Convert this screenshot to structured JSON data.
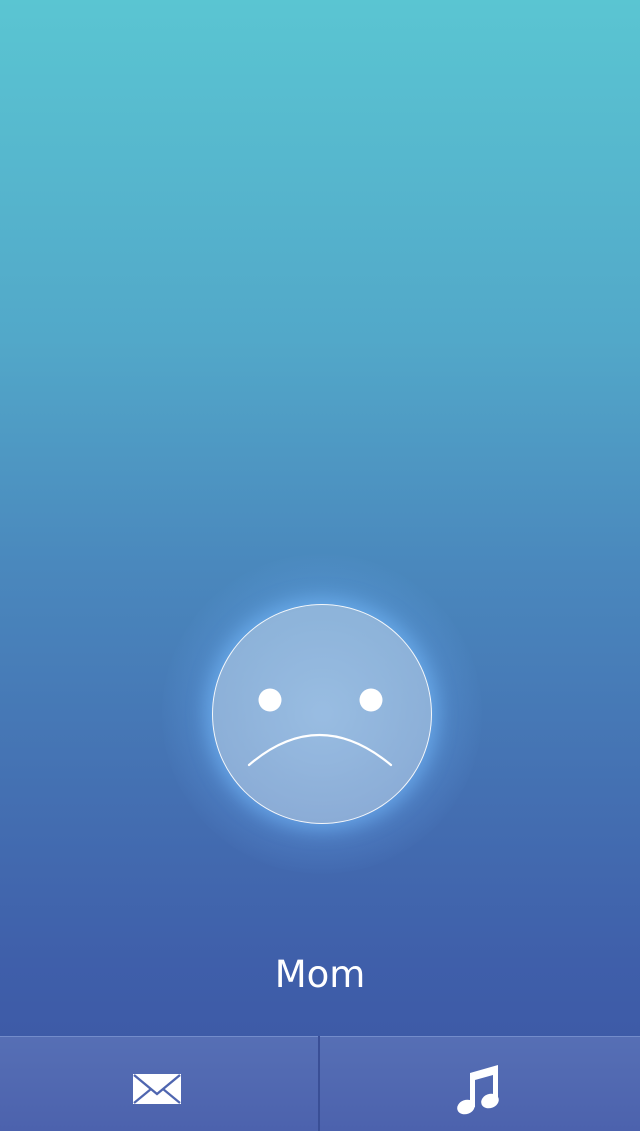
{
  "caller": {
    "name": "Mom",
    "mood": "sad-face-icon"
  },
  "actions": [
    {
      "name": "message",
      "icon": "envelope-icon"
    },
    {
      "name": "ringtone",
      "icon": "music-note-icon"
    }
  ],
  "colors": {
    "gradient_top": "#5ac5d2",
    "gradient_bottom": "#3b55a3",
    "bar": "#4f66b0",
    "foreground": "#ffffff"
  }
}
